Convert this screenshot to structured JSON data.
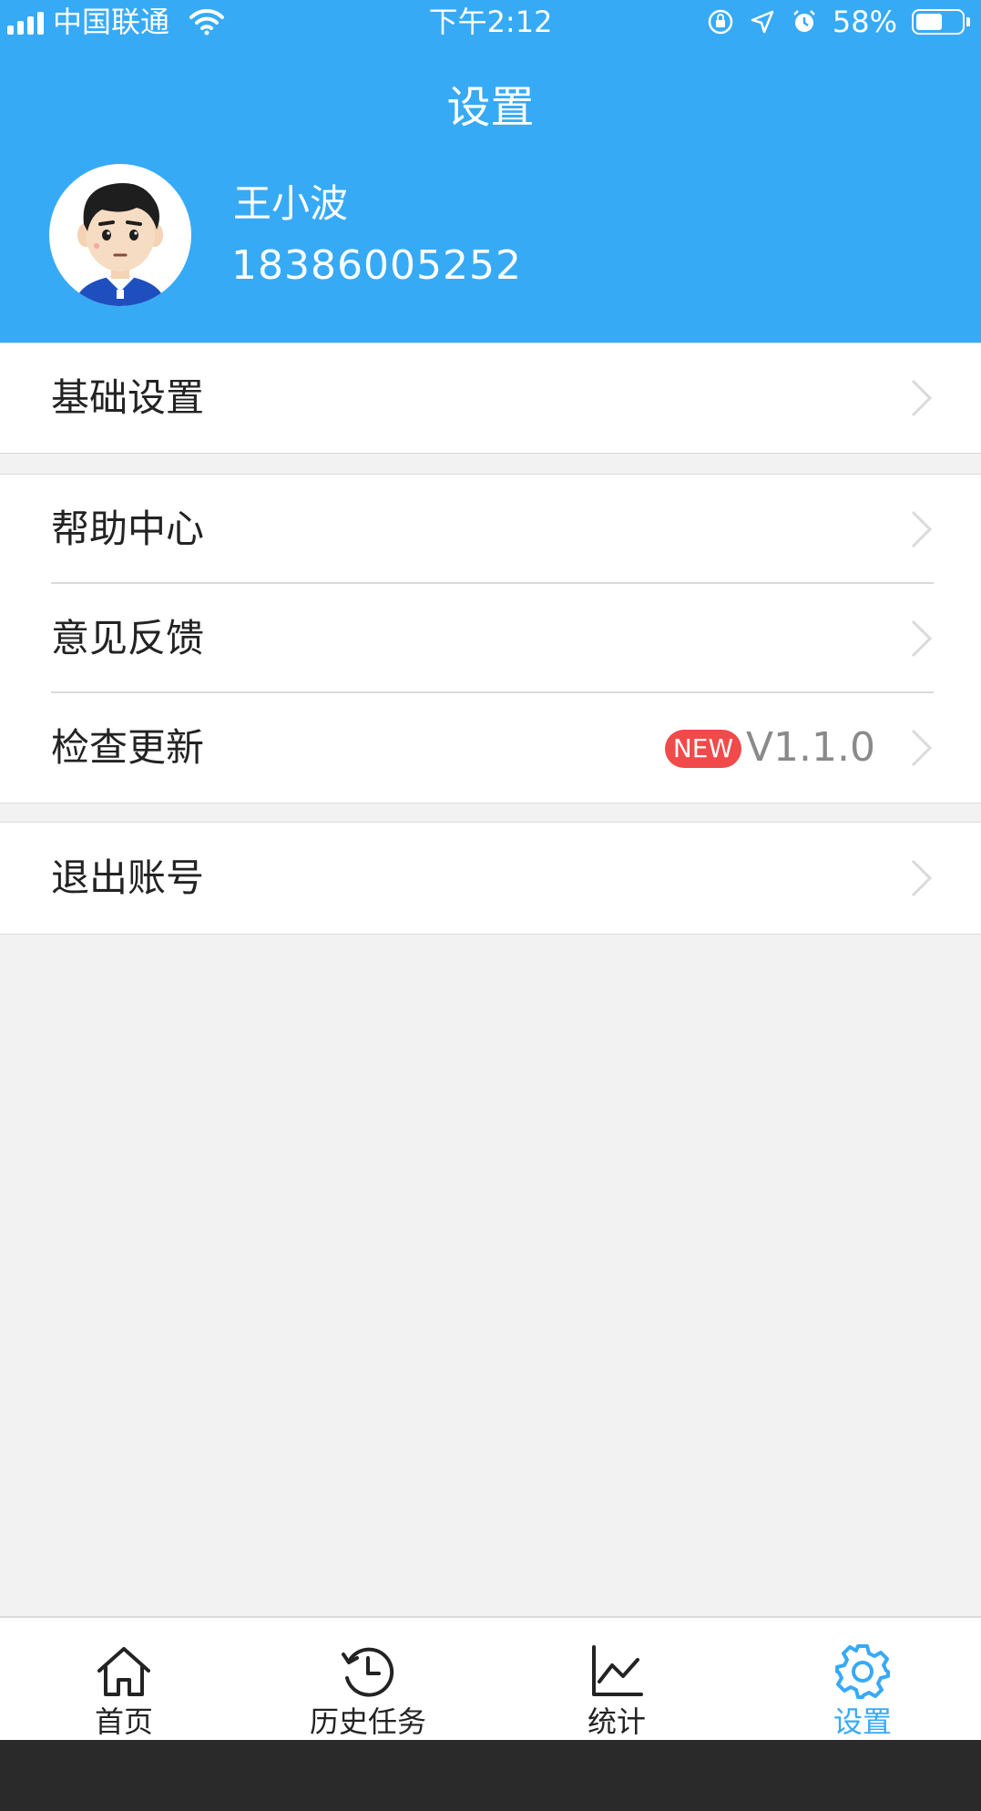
{
  "status_bar": {
    "carrier": "中国联通",
    "time": "下午2:12",
    "battery": "58%",
    "battery_level": 0.58
  },
  "header": {
    "title": "设置",
    "user_name": "王小波",
    "phone": "18386005252"
  },
  "menu": {
    "basic_settings": "基础设置",
    "help_center": "帮助中心",
    "feedback": "意见反馈",
    "check_update": "检查更新",
    "new_badge": "NEW",
    "version": "V1.1.0",
    "logout": "退出账号"
  },
  "tabs": [
    {
      "label": "首页",
      "icon": "home-icon"
    },
    {
      "label": "历史任务",
      "icon": "history-icon"
    },
    {
      "label": "统计",
      "icon": "chart-icon"
    },
    {
      "label": "设置",
      "icon": "gear-icon"
    }
  ],
  "colors": {
    "primary": "#37aaf6",
    "text": "#232323",
    "background": "#f2f2f2",
    "divider": "#dadada",
    "active_tab": "#38a9f7",
    "badge": "#f04a4a"
  }
}
